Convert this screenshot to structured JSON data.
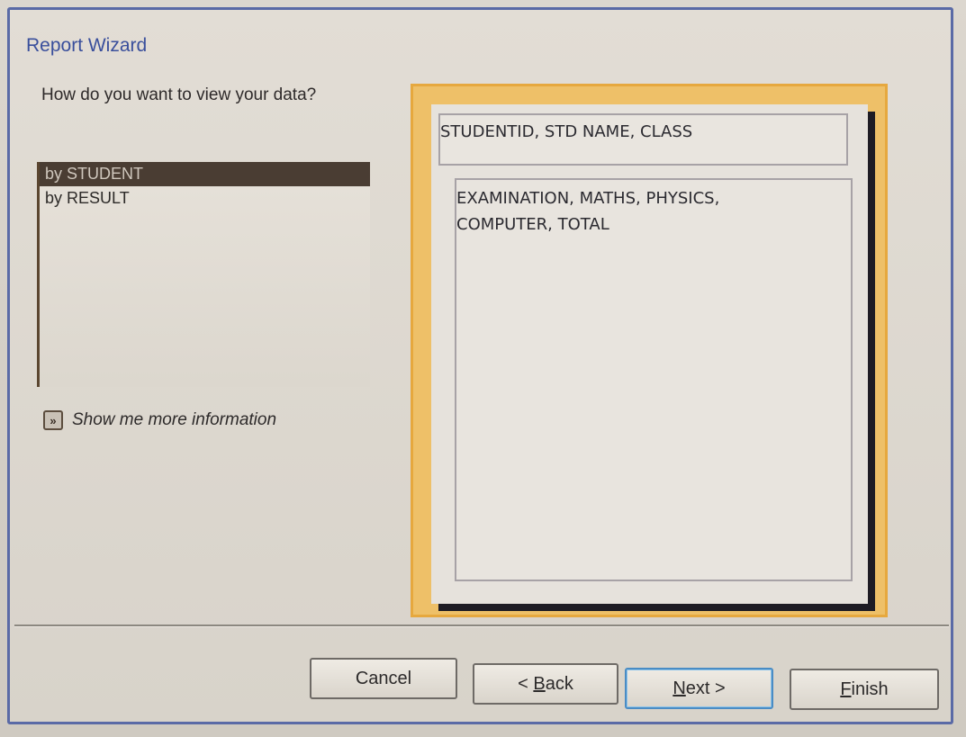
{
  "window": {
    "title": "Report Wizard"
  },
  "prompt": {
    "question": "How do you want to view your data?"
  },
  "view_options": {
    "items": [
      {
        "label": "by STUDENT",
        "selected": true
      },
      {
        "label": "by RESULT",
        "selected": false
      }
    ]
  },
  "more_info": {
    "label": "Show me more information",
    "icon": "expand-arrows-icon"
  },
  "preview": {
    "header_fields": "STUDENTID, STD NAME, CLASS",
    "detail_fields_line1": "EXAMINATION, MATHS, PHYSICS,",
    "detail_fields_line2": "COMPUTER, TOTAL"
  },
  "buttons": {
    "cancel": "Cancel",
    "back_prefix": "< ",
    "back_mnemonic": "B",
    "back_rest": "ack",
    "next_mnemonic": "N",
    "next_rest": "ext >",
    "finish_mnemonic": "F",
    "finish_rest": "inish"
  },
  "colors": {
    "title": "#3a4f9c",
    "selection": "#4a3d33",
    "preview_border": "#e6a83e",
    "default_button_border": "#4a8cc4"
  }
}
